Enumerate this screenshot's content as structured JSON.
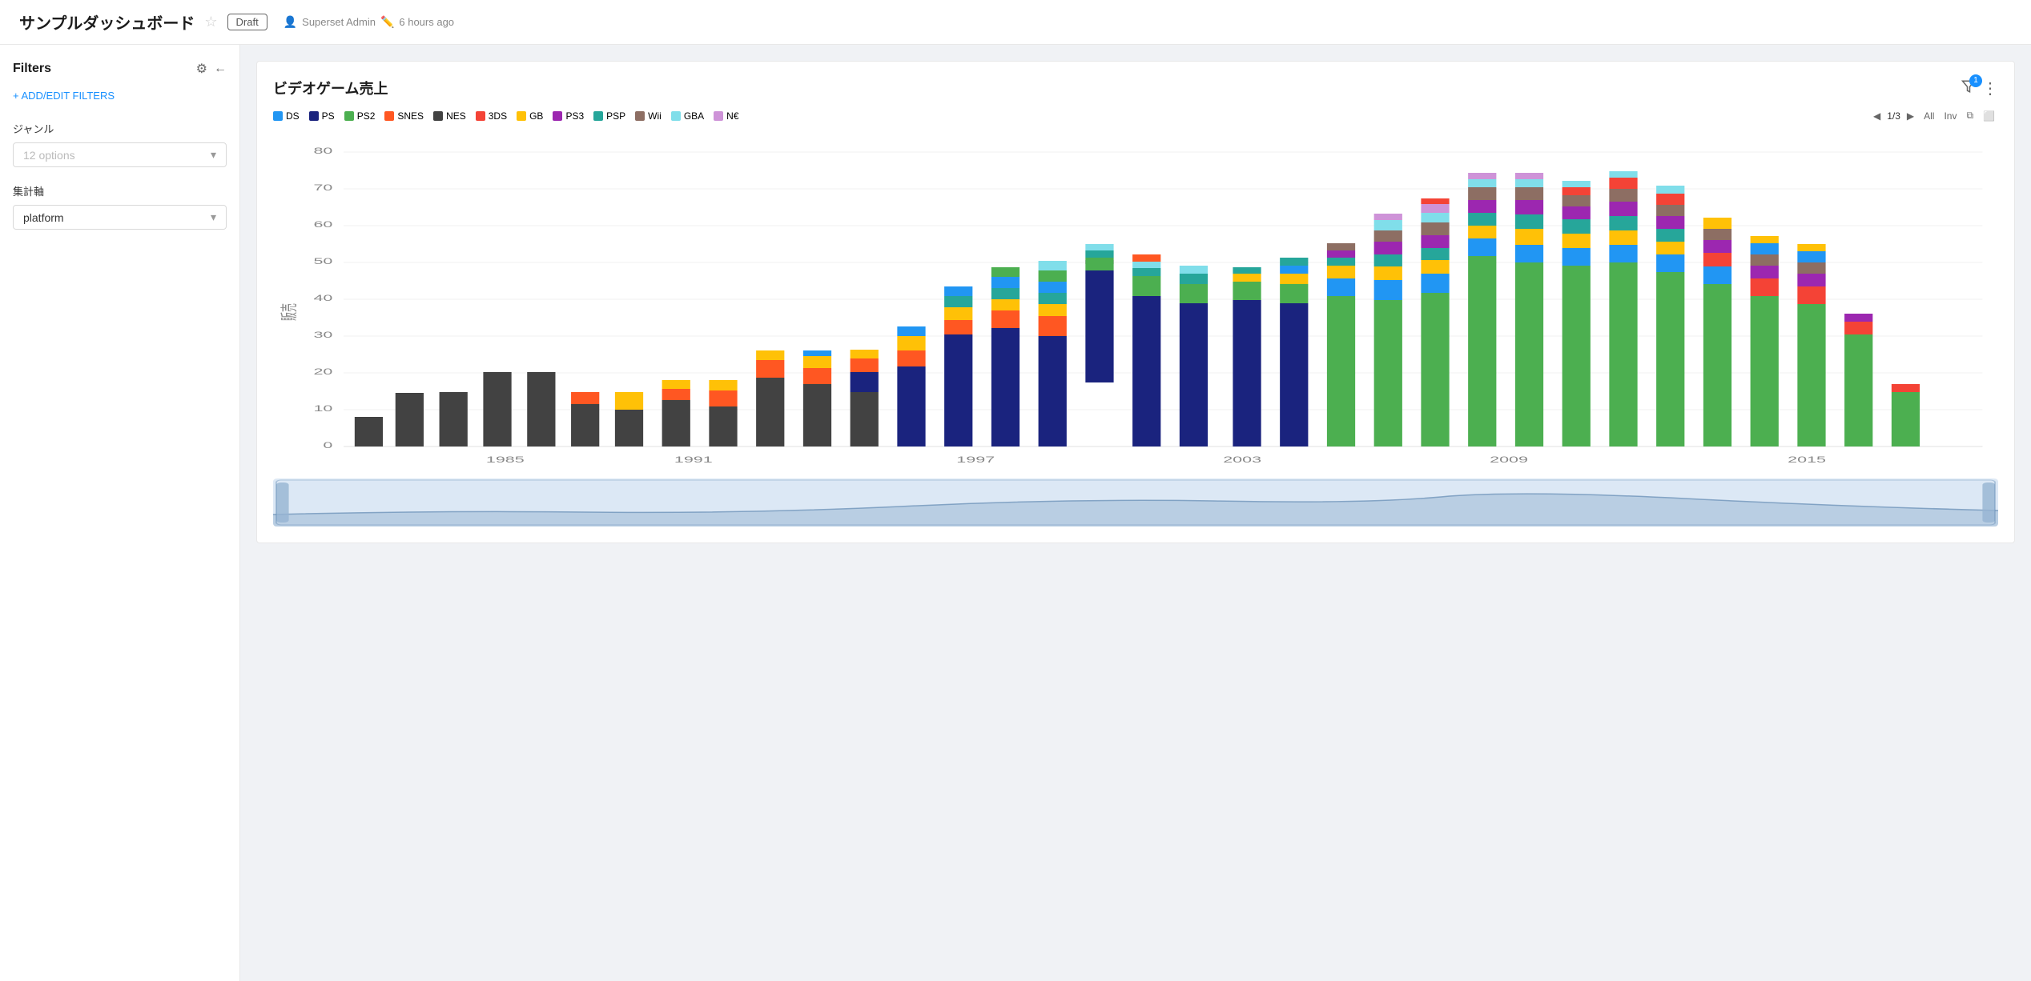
{
  "header": {
    "title": "サンプルダッシュボード",
    "star_label": "☆",
    "draft_label": "Draft",
    "user_label": "Superset Admin",
    "time_label": "6 hours ago"
  },
  "sidebar": {
    "title": "Filters",
    "gear_icon": "⚙",
    "collapse_icon": "←",
    "add_filter_label": "+ ADD/EDIT FILTERS",
    "filter1": {
      "label": "ジャンル",
      "placeholder": "12 options"
    },
    "filter2": {
      "label": "集計軸",
      "value": "platform"
    }
  },
  "chart": {
    "title": "ビデオゲーム売上",
    "filter_count": "1",
    "legend_page": "1/3",
    "legend_all": "All",
    "legend_inv": "Inv",
    "legend_items": [
      {
        "label": "DS",
        "color": "#2196F3"
      },
      {
        "label": "PS",
        "color": "#1a237e"
      },
      {
        "label": "PS2",
        "color": "#4CAF50"
      },
      {
        "label": "SNES",
        "color": "#FF5722"
      },
      {
        "label": "NES",
        "color": "#424242"
      },
      {
        "label": "3DS",
        "color": "#f44336"
      },
      {
        "label": "GB",
        "color": "#FFC107"
      },
      {
        "label": "PS3",
        "color": "#9C27B0"
      },
      {
        "label": "PSP",
        "color": "#26A69A"
      },
      {
        "label": "Wii",
        "color": "#8D6E63"
      },
      {
        "label": "GBA",
        "color": "#80DEEA"
      },
      {
        "label": "N€",
        "color": "#CE93D8"
      }
    ],
    "y_axis_labels": [
      "80",
      "70",
      "60",
      "50",
      "40",
      "30",
      "20",
      "10",
      "0"
    ],
    "x_axis_labels": [
      "1985",
      "1991",
      "1997",
      "2003",
      "2009",
      "2015"
    ],
    "y_axis_title": "販売"
  }
}
